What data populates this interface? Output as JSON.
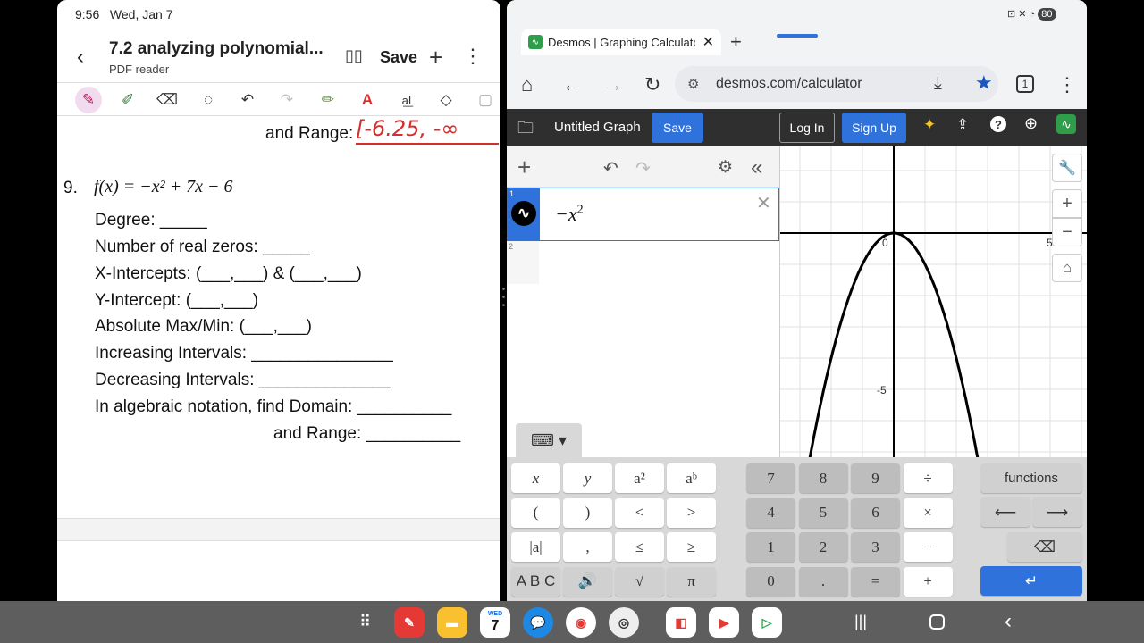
{
  "pdf": {
    "status_time": "9:56",
    "status_date": "Wed, Jan 7",
    "title": "7.2 analyzing polynomial...",
    "subtitle": "PDF reader",
    "save_label": "Save",
    "prev_range_label": "and Range:",
    "handwritten_range": "[-6.25, -∞",
    "problem_number": "9.",
    "function": "f(x) = −x² + 7x − 6",
    "lines": [
      "Degree: _____",
      "Number of real zeros: _____",
      "X-Intercepts: (___,___) & (___,___)",
      "Y-Intercept: (___,___)",
      "Absolute Max/Min: (___,___)",
      "Increasing Intervals: _______________",
      "Decreasing Intervals: ______________",
      "In algebraic notation, find Domain: __________",
      "and Range: __________"
    ]
  },
  "browser": {
    "battery": "80",
    "tab_title": "Desmos | Graphing Calculato",
    "url": "desmos.com/calculator",
    "tab_count": "1"
  },
  "desmos": {
    "graph_title": "Untitled Graph",
    "save_label": "Save",
    "login_label": "Log In",
    "signup_label": "Sign Up",
    "expr1_index": "1",
    "expr2_index": "2",
    "expr1": "−x",
    "expr1_exp": "2",
    "axis_origin": "0",
    "axis_x5": "5",
    "axis_y_neg5": "-5",
    "functions_label": "functions",
    "curve_color": "#000000",
    "accent": "#2f72dc"
  },
  "keypad": {
    "left": [
      "x",
      "y",
      "a²",
      "aᵇ",
      "(",
      ")",
      "<",
      ">",
      "|a|",
      ",",
      "≤",
      "≥",
      "A B C",
      "🔊",
      "√",
      "π"
    ],
    "nums": [
      "7",
      "8",
      "9",
      "÷",
      "4",
      "5",
      "6",
      "×",
      "1",
      "2",
      "3",
      "−",
      "0",
      ".",
      "=",
      "+"
    ]
  },
  "dock": {
    "calendar_day": "7",
    "calendar_month": "WED"
  }
}
